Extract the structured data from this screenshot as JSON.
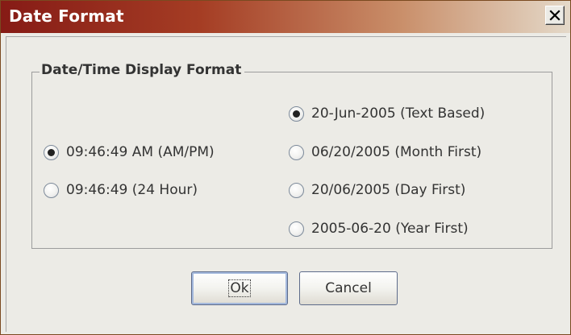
{
  "window": {
    "title": "Date Format"
  },
  "group": {
    "legend": "Date/Time Display Format"
  },
  "time_options": [
    {
      "label": "09:46:49 AM (AM/PM)",
      "selected": true
    },
    {
      "label": "09:46:49 (24 Hour)",
      "selected": false
    }
  ],
  "date_options": [
    {
      "label": "20-Jun-2005 (Text Based)",
      "selected": true
    },
    {
      "label": "06/20/2005 (Month First)",
      "selected": false
    },
    {
      "label": "20/06/2005 (Day First)",
      "selected": false
    },
    {
      "label": "2005-06-20 (Year First)",
      "selected": false
    }
  ],
  "buttons": {
    "ok": "Ok",
    "cancel": "Cancel"
  },
  "icons": {
    "close": "close-icon"
  },
  "colors": {
    "titlebar_start": "#861b16",
    "titlebar_end": "#e4d9c9",
    "dialog_background": "#ecebe6"
  }
}
